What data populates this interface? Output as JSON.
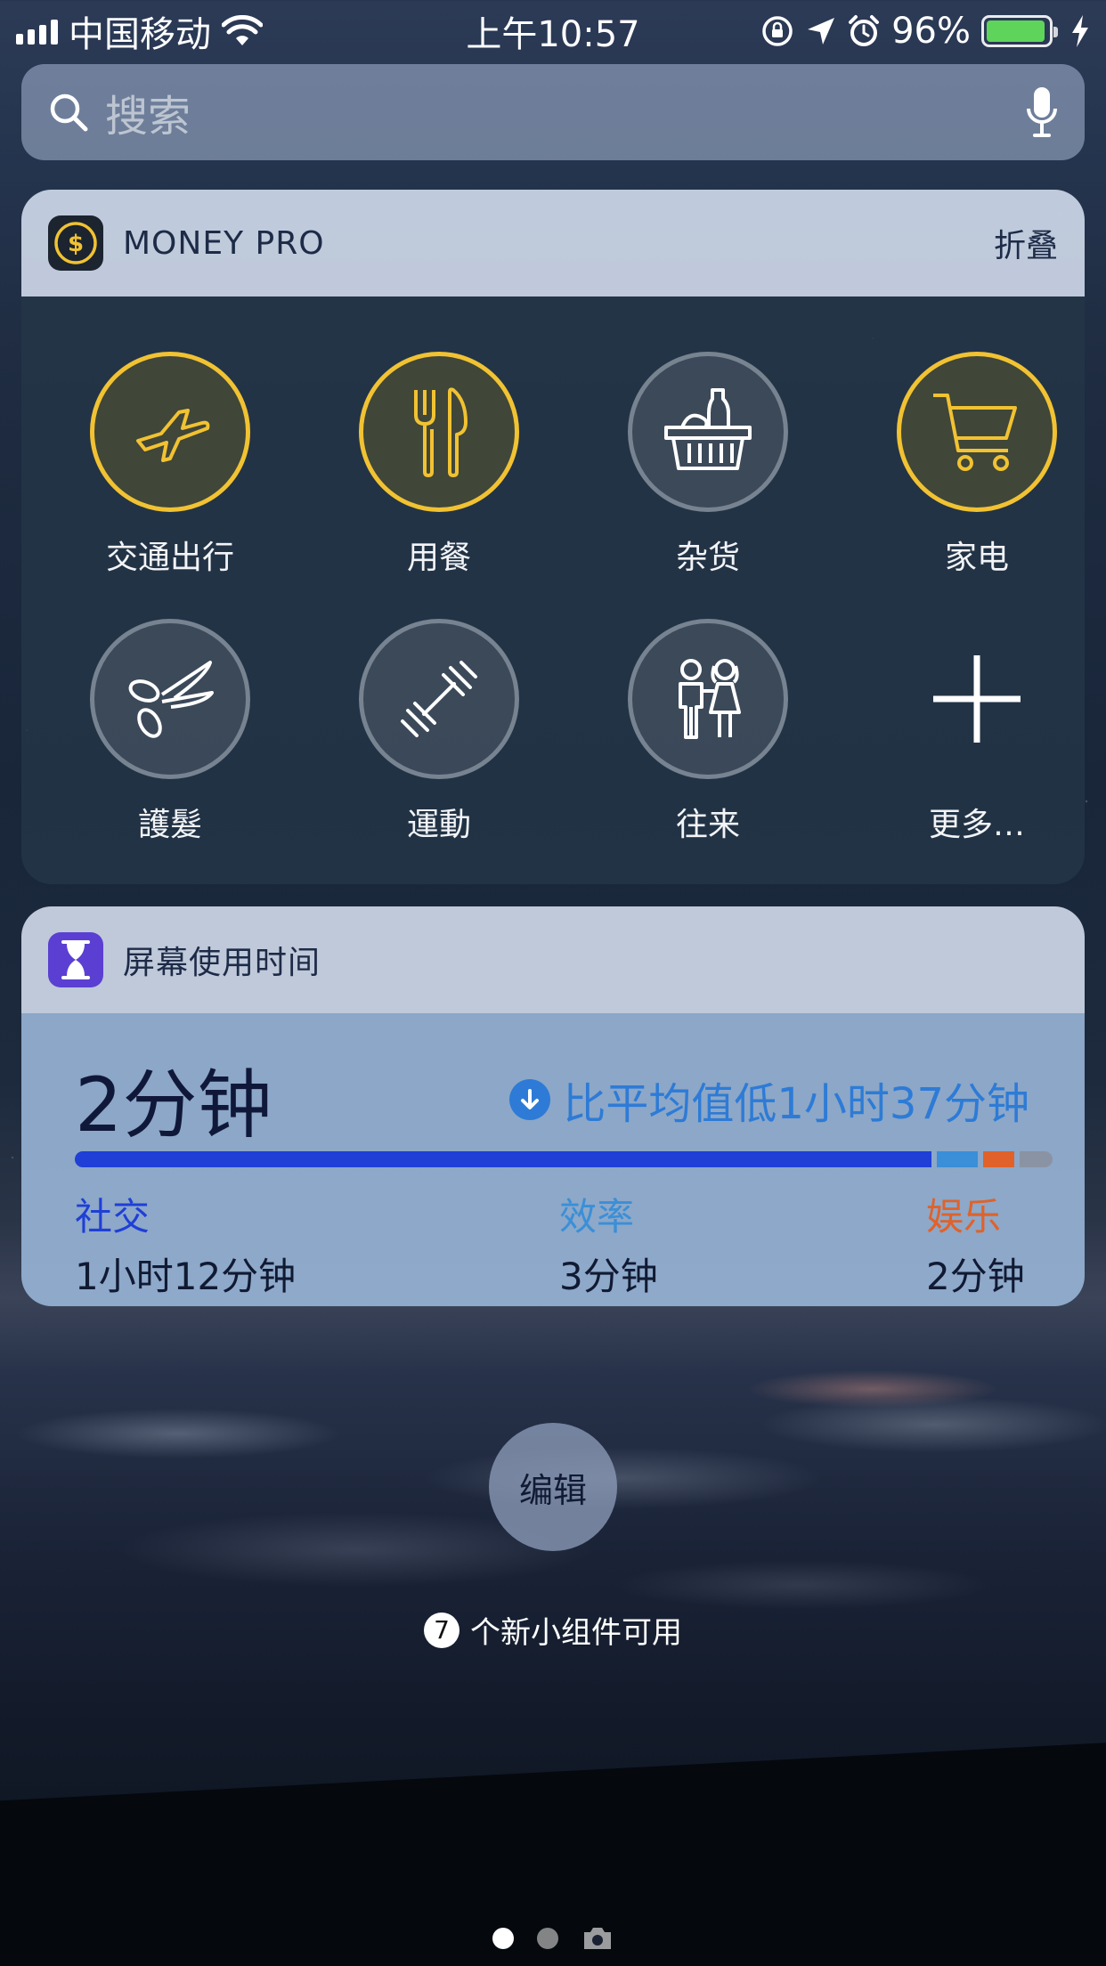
{
  "status_bar": {
    "carrier": "中国移动",
    "time": "上午10:57",
    "battery_percent": "96%",
    "battery_level": 0.96,
    "icons": [
      "signal-icon",
      "wifi-icon",
      "rotation-lock-icon",
      "location-icon",
      "alarm-icon",
      "battery-icon",
      "charging-icon"
    ]
  },
  "search": {
    "placeholder": "搜索",
    "icons": [
      "search-icon",
      "microphone-icon"
    ]
  },
  "money_pro": {
    "title": "MONEY PRO",
    "collapse_label": "折叠",
    "accent_color": "#f1c232",
    "categories": [
      {
        "label": "交通出行",
        "icon": "airplane-icon",
        "active": true
      },
      {
        "label": "用餐",
        "icon": "fork-knife-icon",
        "active": true
      },
      {
        "label": "杂货",
        "icon": "grocery-basket-icon",
        "active": false
      },
      {
        "label": "家电",
        "icon": "shopping-cart-icon",
        "active": true
      },
      {
        "label": "護髮",
        "icon": "scissors-icon",
        "active": false
      },
      {
        "label": "運動",
        "icon": "dumbbell-icon",
        "active": false
      },
      {
        "label": "往来",
        "icon": "people-icon",
        "active": false
      },
      {
        "label": "更多…",
        "icon": "plus-icon",
        "active": false
      }
    ]
  },
  "screen_time": {
    "title": "屏幕使用时间",
    "total": "2分钟",
    "comparison": "比平均值低1小时37分钟",
    "breakdown": [
      {
        "category": "社交",
        "value": "1小时12分钟",
        "color": "#1f3fd6"
      },
      {
        "category": "效率",
        "value": "3分钟",
        "color": "#3a8fd8"
      },
      {
        "category": "娱乐",
        "value": "2分钟",
        "color": "#e0622a"
      }
    ],
    "bar_segments": [
      {
        "share": 0.891,
        "color": "#1f3fd6"
      },
      {
        "share": 0.042,
        "color": "#3a8fd8"
      },
      {
        "share": 0.033,
        "color": "#e0622a"
      },
      {
        "share": 0.034,
        "color": "#8a93a3"
      }
    ]
  },
  "edit_label": "编辑",
  "new_widgets": {
    "count": "7",
    "text": "个新小组件可用"
  },
  "page_indicator": {
    "pages": 2,
    "current": 1,
    "icons": [
      "camera-icon"
    ]
  }
}
